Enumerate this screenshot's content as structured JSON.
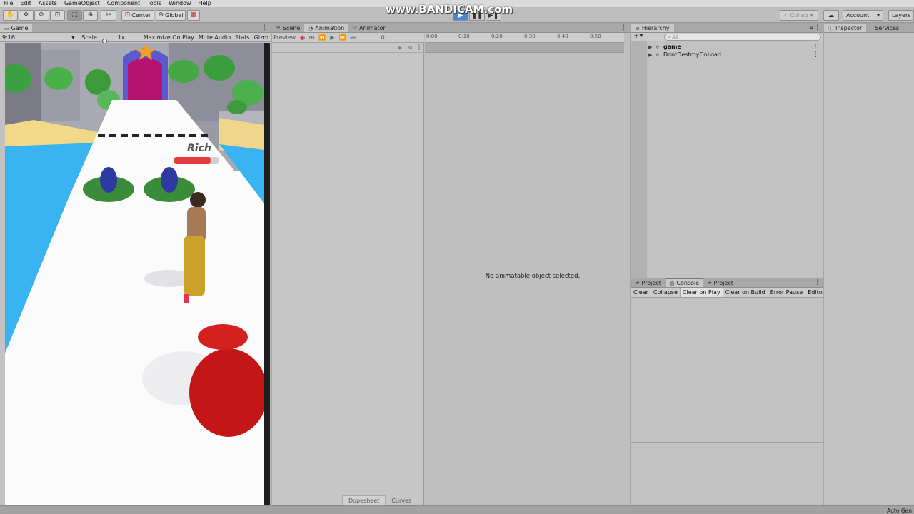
{
  "menu": [
    "File",
    "Edit",
    "Assets",
    "GameObject",
    "Component",
    "Tools",
    "Window",
    "Help"
  ],
  "toolbar": {
    "tools": [
      "hand-icon",
      "move-icon",
      "rotate-icon",
      "scale-icon",
      "rect-icon",
      "transform-icon",
      "custom-tool-icon"
    ],
    "pivot_label": "Center",
    "space_label": "Global",
    "collab_label": "Collab",
    "account_label": "Account",
    "layers_label": "Layers"
  },
  "watermark": "www.BANDICAM.com",
  "game": {
    "tab_label": "Game",
    "aspect": "9:16",
    "scale_label": "Scale",
    "scale_value": "1x",
    "maximize_label": "Maximize On Play",
    "mute_label": "Mute Audio",
    "stats_label": "Stats",
    "gizmos_label": "Gizm",
    "rich_label": "Rich",
    "rich_progress": 0.82
  },
  "animation": {
    "tabs": [
      "Scene",
      "Animation",
      "Animator"
    ],
    "preview_label": "Preview",
    "frame_value": "0",
    "timeline_ticks": [
      "0:00",
      "0:10",
      "0:20",
      "0:30",
      "0:40",
      "0:50"
    ],
    "empty_message": "No animatable object selected.",
    "bottom_tabs": [
      "Dopesheet",
      "Curves"
    ]
  },
  "hierarchy": {
    "tab_label": "Hierarchy",
    "search_placeholder": "All",
    "items": [
      "game",
      "DontDestroyOnLoad"
    ]
  },
  "console": {
    "tabs": [
      "Project",
      "Console",
      "Project"
    ],
    "buttons": [
      "Clear",
      "Collapse",
      "Clear on Play",
      "Clear on Build",
      "Error Pause",
      "Edito"
    ]
  },
  "inspector": {
    "tabs": [
      "Inspector",
      "Services"
    ]
  },
  "status": {
    "text": "Auto Gen"
  },
  "colors": {
    "editor_bg": "#c2c2c2",
    "play_active": "#4a86d8",
    "rich_bar": "#e43c3c",
    "water": "#39b4f0",
    "money": "#3a8c3a"
  }
}
